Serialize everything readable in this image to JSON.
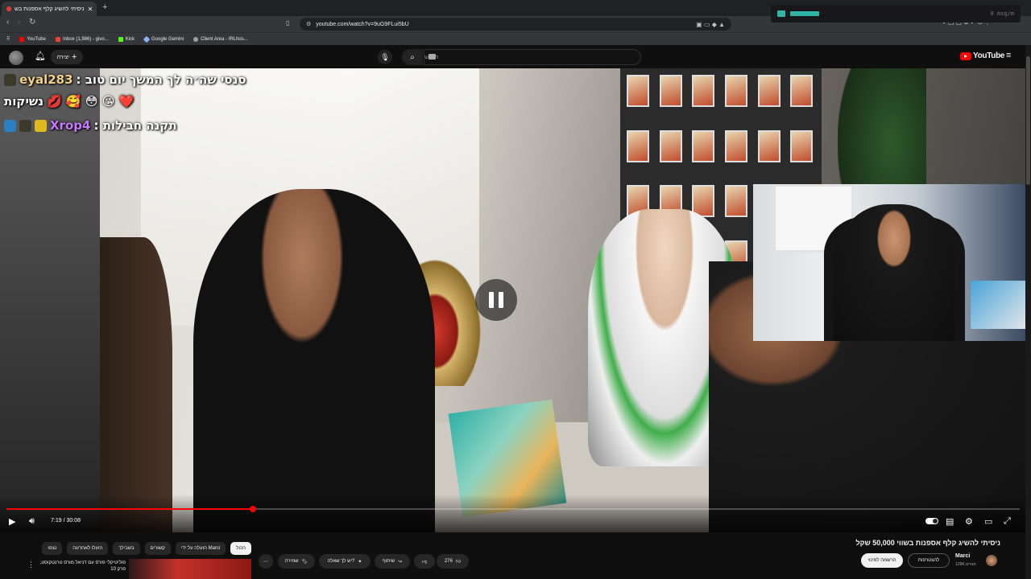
{
  "browser": {
    "tab_title": "ניסיתי להשיג קלף אספנות בש",
    "new_tab": "+",
    "url": "youtube.com/watch?v=9uG9FLui5bU",
    "bookmarks": [
      {
        "label": "YouTube",
        "color": "#ff0000"
      },
      {
        "label": "Inbox (1,986) - givo...",
        "color": "#ea4335"
      },
      {
        "label": "Kick",
        "color": "#53fc18"
      },
      {
        "label": "Google Gemini",
        "color": "#8ab4f8"
      },
      {
        "label": "Client Area - IRLhos...",
        "color": "#9aa0a6"
      }
    ]
  },
  "overlay": {
    "text": "0 msg/m",
    "accent": "#2fb5a5"
  },
  "header": {
    "create_label": "יצירה",
    "search_placeholder": "חיפוש",
    "logo_text": "YouTube"
  },
  "chat": [
    {
      "user": "eyal283",
      "message": ": סנסי שה׳ה לך המשך יום טוב",
      "emotes": "",
      "user_color": "#f2d388"
    },
    {
      "user": "",
      "message": "נשיקות",
      "emotes": "💋 🥰 😳 😘 ❤️",
      "user_color": "#ffffff"
    },
    {
      "user": "Xrop4",
      "message": ": תקנה חבילות",
      "emotes": "",
      "user_color": "#c678ff"
    }
  ],
  "player": {
    "current_time": "7:19",
    "duration": "30:08",
    "time_display": "7:19 / 30:08",
    "progress": 0.243
  },
  "video": {
    "title": "ניסיתי להשיג קלף אספנות בשווי 50,000 שקל",
    "channel": "Marci",
    "subscribers": "129K מנויים",
    "subscribe_label": "הרשמה למינוי",
    "join_label": "להצטרפות",
    "likes": "276",
    "share_label": "שיתוף",
    "ask_label": "יש לך שאלה?",
    "save_label": "שמירה"
  },
  "chips": [
    "הכול",
    "הועלה על ידי Marci",
    "קשורים",
    "בשבילך",
    "הועלו לאחרונה",
    "נצפו"
  ],
  "recommendation": {
    "title": "פוליטיקלי פורס עם דניאל מורס טרנטקוסט, פרק 10"
  }
}
